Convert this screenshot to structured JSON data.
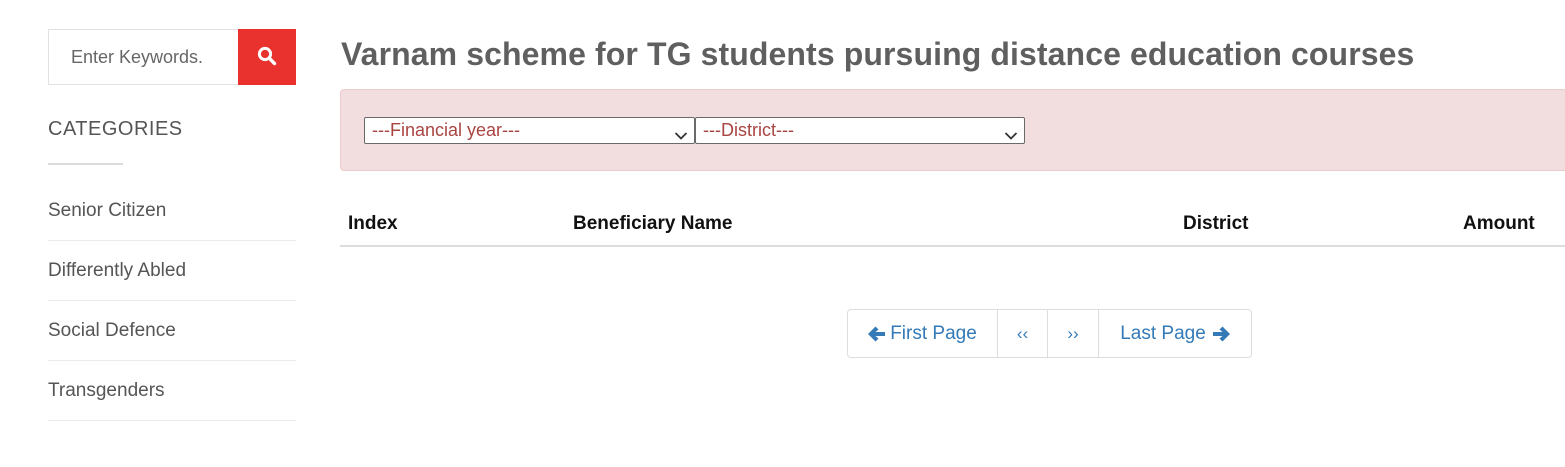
{
  "search": {
    "placeholder": "Enter Keywords."
  },
  "sidebar": {
    "categories_title": "CATEGORIES",
    "items": [
      {
        "label": "Senior Citizen"
      },
      {
        "label": "Differently Abled"
      },
      {
        "label": "Social Defence"
      },
      {
        "label": "Transgenders"
      }
    ]
  },
  "main": {
    "title": "Varnam scheme for TG students pursuing distance education courses",
    "filters": {
      "financial_year": "---Financial year---",
      "district": "---District---"
    },
    "table": {
      "columns": [
        "Index",
        "Beneficiary Name",
        "District",
        "Amount"
      ],
      "rows": []
    },
    "pagination": {
      "first": "First Page",
      "prev": "‹‹",
      "next": "››",
      "last": "Last Page"
    }
  },
  "colors": {
    "search_button": "#e9322e",
    "filter_background": "#f2dede",
    "select_text": "#a94442",
    "link": "#337ab7"
  },
  "icons": {
    "search_button": "search-icon",
    "select_toggle": "chevron-down-icon",
    "first_page": "arrow-left-icon",
    "last_page": "arrow-right-icon"
  }
}
